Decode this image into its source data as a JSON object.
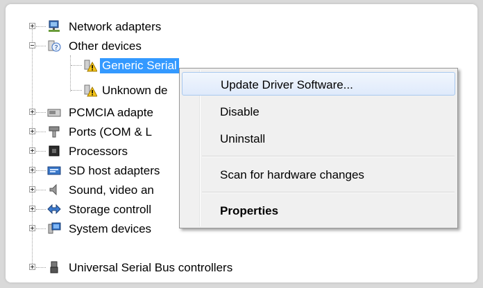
{
  "tree": {
    "items": [
      {
        "label": "Network adapters",
        "expander": "plus",
        "icon": "network-adapter-icon"
      },
      {
        "label": "Other devices",
        "expander": "minus",
        "icon": "unknown-device-folder-icon"
      },
      {
        "label": "Generic Serial",
        "expander": "none",
        "icon": "warning-device-icon",
        "selected": true
      },
      {
        "label": "Unknown de",
        "expander": "none",
        "icon": "warning-device-icon"
      },
      {
        "label": "PCMCIA adapte",
        "expander": "plus",
        "icon": "pcmcia-icon"
      },
      {
        "label": "Ports (COM & L",
        "expander": "plus",
        "icon": "port-icon"
      },
      {
        "label": "Processors",
        "expander": "plus",
        "icon": "processor-icon"
      },
      {
        "label": "SD host adapters",
        "expander": "plus",
        "icon": "sd-host-icon"
      },
      {
        "label": "Sound, video an",
        "expander": "plus",
        "icon": "speaker-icon"
      },
      {
        "label": "Storage controll",
        "expander": "plus",
        "icon": "storage-controller-icon"
      },
      {
        "label": "System devices",
        "expander": "plus",
        "icon": "system-devices-icon"
      },
      {
        "label": "Universal Serial Bus controllers",
        "expander": "plus",
        "icon": "usb-icon"
      }
    ]
  },
  "context_menu": {
    "items": [
      {
        "label": "Update Driver Software...",
        "hover": true
      },
      {
        "label": "Disable"
      },
      {
        "label": "Uninstall"
      },
      {
        "label": "Scan for hardware changes"
      },
      {
        "label": "Properties",
        "bold": true
      }
    ]
  },
  "colors": {
    "selection": "#3399ff",
    "menu_bg": "#f0f0f0",
    "hover_border": "#a8c8ee"
  }
}
